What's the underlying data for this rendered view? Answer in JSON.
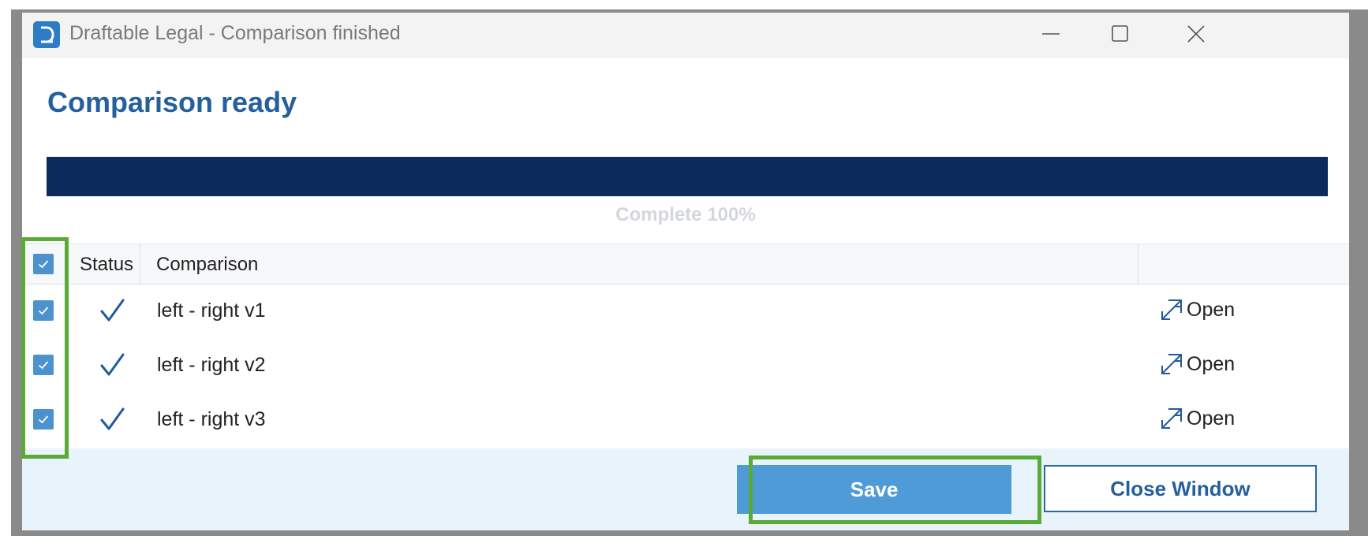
{
  "window": {
    "title": "Draftable Legal - Comparison finished",
    "controls": [
      "minimize",
      "maximize",
      "close"
    ]
  },
  "heading": "Comparison ready",
  "progress": {
    "percent": 100,
    "label": "Complete 100%",
    "fill_color": "#0c2b5c"
  },
  "table": {
    "headers": {
      "status": "Status",
      "comparison": "Comparison"
    },
    "select_all_checked": true,
    "rows": [
      {
        "checked": true,
        "status": "complete",
        "name": "left - right v1",
        "action": "Open"
      },
      {
        "checked": true,
        "status": "complete",
        "name": "left - right v2",
        "action": "Open"
      },
      {
        "checked": true,
        "status": "complete",
        "name": "left - right v3",
        "action": "Open"
      }
    ]
  },
  "footer": {
    "save_label": "Save",
    "close_label": "Close Window"
  },
  "icons": {
    "app": "draftable-logo-icon",
    "minimize": "minimize-icon",
    "maximize": "maximize-icon",
    "close": "close-icon",
    "checkbox": "checkbox-checked-icon",
    "status": "checkmark-icon",
    "open": "open-external-icon"
  },
  "colors": {
    "accent": "#4f9bd7",
    "heading": "#255f9e",
    "highlight": "#5aab35",
    "footer_bg": "#e9f3fb"
  }
}
